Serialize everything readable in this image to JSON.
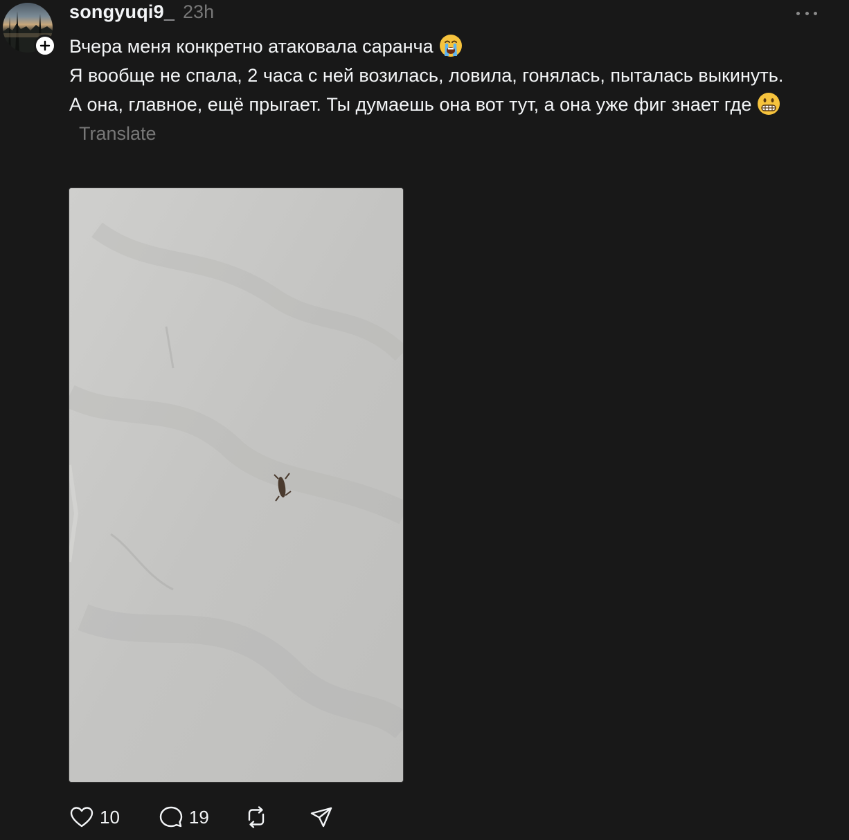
{
  "post": {
    "username": "songyuqi9_",
    "time": "23h",
    "lines": [
      "Вчера меня конкретно атаковала саранча",
      "Я вообще не спала, 2 часа с ней возилась, ловила, гонялась, пыталась выкинуть.",
      "А она, главное, ещё прыгает. Ты думаешь она вот тут, а она уже фиг знает где"
    ],
    "translate_label": "Translate",
    "emojis": [
      "loudly-crying-face",
      "grimacing-face"
    ]
  },
  "actions": {
    "likes": "10",
    "comments": "19"
  },
  "icons": [
    "plus-icon",
    "more-icon",
    "heart-icon",
    "comment-icon",
    "repost-icon",
    "share-icon"
  ],
  "colors": {
    "background": "#181818",
    "text": "#f3f5f7",
    "muted": "#777777"
  }
}
